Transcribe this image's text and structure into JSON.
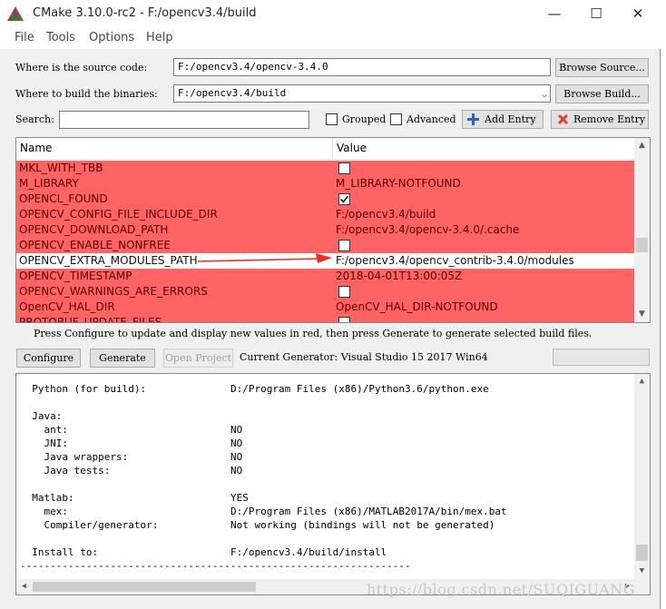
{
  "window": {
    "title": "CMake 3.10.0-rc2 - F:/opencv3.4/build",
    "controls": {
      "minimize": "—",
      "maximize": "☐",
      "close": "✕"
    }
  },
  "menu": [
    "File",
    "Tools",
    "Options",
    "Help"
  ],
  "source": {
    "label": "Where is the source code:",
    "value": "F:/opencv3.4/opencv-3.4.0",
    "button": "Browse Source..."
  },
  "binaries": {
    "label": "Where to build the binaries:",
    "value": "F:/opencv3.4/build",
    "button": "Browse Build..."
  },
  "search": {
    "label": "Search:",
    "value": ""
  },
  "options": {
    "grouped": "Grouped",
    "advanced": "Advanced",
    "add_entry": "Add Entry",
    "remove_entry": "Remove Entry"
  },
  "table": {
    "columns": [
      "Name",
      "Value"
    ],
    "rows": [
      {
        "name": "MKL_WITH_TBB",
        "value": "",
        "type": "checkbox",
        "checked": false,
        "highlight": "red"
      },
      {
        "name": "M_LIBRARY",
        "value": "M_LIBRARY-NOTFOUND",
        "type": "text",
        "highlight": "red"
      },
      {
        "name": "OPENCL_FOUND",
        "value": "",
        "type": "checkbox",
        "checked": true,
        "highlight": "red"
      },
      {
        "name": "OPENCV_CONFIG_FILE_INCLUDE_DIR",
        "value": "F:/opencv3.4/build",
        "type": "text",
        "highlight": "red"
      },
      {
        "name": "OPENCV_DOWNLOAD_PATH",
        "value": "F:/opencv3.4/opencv-3.4.0/.cache",
        "type": "text",
        "highlight": "red"
      },
      {
        "name": "OPENCV_ENABLE_NONFREE",
        "value": "",
        "type": "checkbox",
        "checked": false,
        "highlight": "red"
      },
      {
        "name": "OPENCV_EXTRA_MODULES_PATH",
        "value": "F:/opencv3.4/opencv_contrib-3.4.0/modules",
        "type": "text",
        "highlight": "none"
      },
      {
        "name": "OPENCV_TIMESTAMP",
        "value": "2018-04-01T13:00:05Z",
        "type": "text",
        "highlight": "red"
      },
      {
        "name": "OPENCV_WARNINGS_ARE_ERRORS",
        "value": "",
        "type": "checkbox",
        "checked": false,
        "highlight": "red"
      },
      {
        "name": "OpenCV_HAL_DIR",
        "value": "OpenCV_HAL_DIR-NOTFOUND",
        "type": "text",
        "highlight": "red"
      },
      {
        "name": "PROTOBUF_UPDATE_FILES",
        "value": "",
        "type": "checkbox",
        "checked": false,
        "highlight": "red"
      }
    ],
    "annotation_color": "#e8302a"
  },
  "hint": "Press Configure to update and display new values in red, then press Generate to generate selected build files.",
  "actions": {
    "configure": "Configure",
    "generate": "Generate",
    "open_project": "Open Project",
    "generator": "Current Generator: Visual Studio 15 2017 Win64"
  },
  "output": [
    {
      "label": "  Python (for build):",
      "value": "D:/Program Files (x86)/Python3.6/python.exe"
    },
    {
      "label": "",
      "value": ""
    },
    {
      "label": "  Java:",
      "value": ""
    },
    {
      "label": "    ant:",
      "value": "NO"
    },
    {
      "label": "    JNI:",
      "value": "NO"
    },
    {
      "label": "    Java wrappers:",
      "value": "NO"
    },
    {
      "label": "    Java tests:",
      "value": "NO"
    },
    {
      "label": "",
      "value": ""
    },
    {
      "label": "  Matlab:",
      "value": "YES"
    },
    {
      "label": "    mex:",
      "value": "D:/Program Files (x86)/MATLAB2017A/bin/mex.bat"
    },
    {
      "label": "    Compiler/generator:",
      "value": "Not working (bindings will not be generated)"
    },
    {
      "label": "",
      "value": ""
    },
    {
      "label": "  Install to:",
      "value": "F:/opencv3.4/build/install"
    },
    {
      "label": "-----------------------------------------------------------------",
      "value": ""
    }
  ],
  "watermark": "https://blog.csdn.net/SUQIGUANG",
  "colors": {
    "changed_row": "#ff6464",
    "accent": "#0078d7"
  }
}
